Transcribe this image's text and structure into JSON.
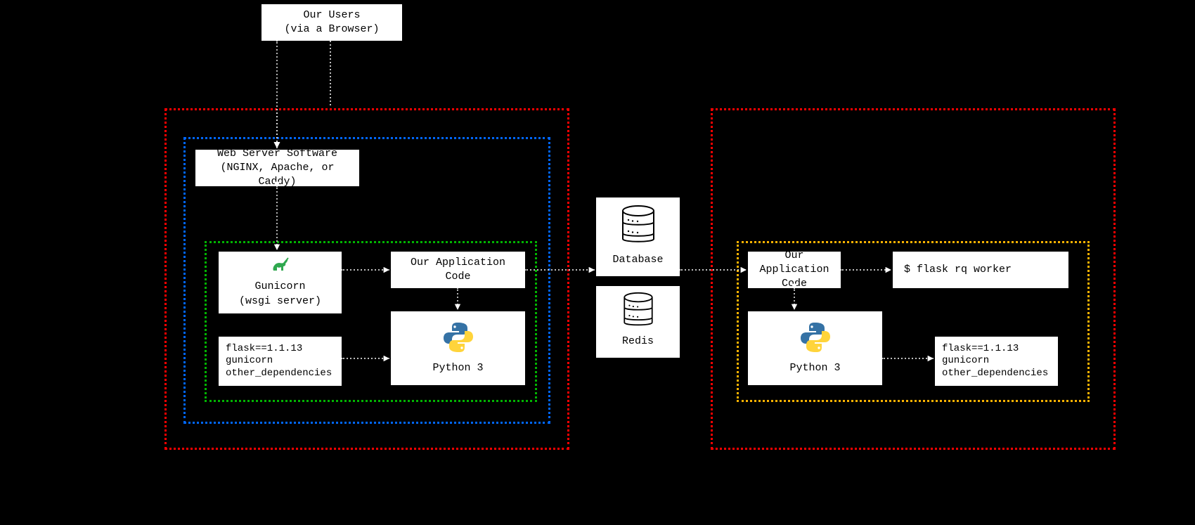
{
  "users": {
    "l1": "Our Users",
    "l2": "(via a Browser)"
  },
  "webserver": {
    "l1": "Web Server Software",
    "l2": "(NGINX, Apache, or Caddy)"
  },
  "gunicorn": {
    "l1": "Gunicorn",
    "l2": "(wsgi server)"
  },
  "appcode": {
    "label": "Our Application Code"
  },
  "python": {
    "label": "Python 3"
  },
  "deps": {
    "l1": "flask==1.1.13",
    "l2": "gunicorn",
    "l3": "other_dependencies"
  },
  "database": {
    "label": "Database"
  },
  "redis": {
    "label": "Redis"
  },
  "appcode2": {
    "label": "Our Application Code"
  },
  "worker": {
    "label": "$ flask rq worker"
  },
  "python2": {
    "label": "Python 3"
  },
  "deps2": {
    "l1": "flask==1.1.13",
    "l2": "gunicorn",
    "l3": "other_dependencies"
  }
}
